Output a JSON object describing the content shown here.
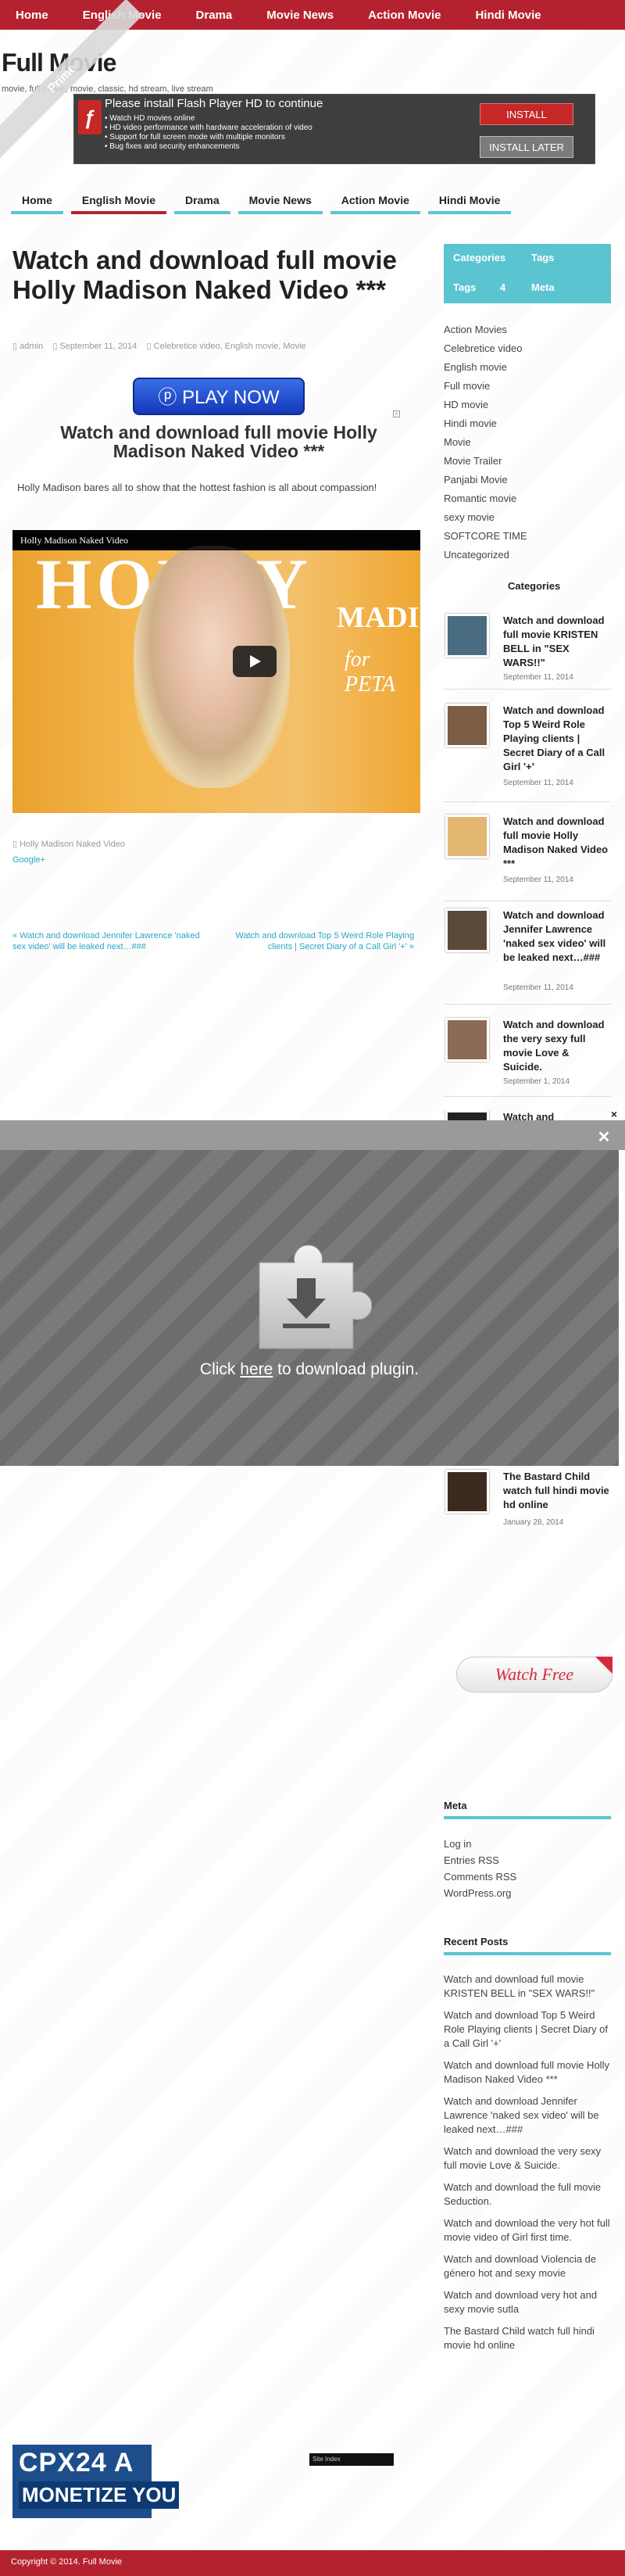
{
  "top_nav": [
    "Home",
    "English Movie",
    "Drama",
    "Movie News",
    "Action Movie",
    "Hindi Movie"
  ],
  "site": {
    "title": "Full Movie",
    "tagline": "movie, full movie, movie, classic, hd stream, live stream"
  },
  "flash_ad": {
    "message": "Please install Flash Player HD to continue",
    "features": [
      "Watch HD movies online",
      "HD video performance with hardware  acceleration of  video",
      "Support for full screen mode with  multiple monitors",
      "Bug fixes and security enhancements"
    ],
    "install": "INSTALL",
    "install_later": "INSTALL LATER",
    "corner_ribbon": "Prime"
  },
  "main_nav": [
    "Home",
    "English Movie",
    "Drama",
    "Movie News",
    "Action Movie",
    "Hindi Movie"
  ],
  "post": {
    "title": "Watch and download full movie Holly Madison Naked Video ***",
    "author": "admin",
    "date": "September 11, 2014",
    "categories": "Celebretice video, English movie, Movie",
    "play_now": "PLAY NOW",
    "subtitle": "Watch and download full movie Holly Madison Naked Video ***",
    "excerpt": "Holly Madison bares all to show that the hottest fashion is all about compassion!",
    "video_title": "Holly Madison Naked Video",
    "video_overlay": {
      "holly": "HOLLY",
      "madison": "MADIS",
      "peta": "for PETA"
    },
    "caption": "Holly Madison Naked Video",
    "google_plus": "Google+",
    "prev_link": "« Watch and download Jennifer Lawrence 'naked sex video' will be leaked next…###",
    "next_link": "Watch and download Top 5 Weird Role Playing clients | Secret Diary of a Call Girl '+' »"
  },
  "sidebar": {
    "tabs": [
      "Categories",
      "Tags",
      "Tags",
      "4",
      "Meta"
    ],
    "categories": [
      "Action Movies",
      "Celebretice video",
      "English movie",
      "Full movie",
      "HD movie",
      "Hindi movie",
      "Movie",
      "Movie Trailer",
      "Panjabi Movie",
      "Romantic movie",
      "sexy movie",
      "SOFTCORE TIME",
      "Uncategorized"
    ],
    "categories_heading": "Categories",
    "posts": [
      {
        "title": "Watch and download full movie KRISTEN BELL in \"SEX WARS!!\"",
        "date": "September 11, 2014"
      },
      {
        "title": "Watch and download Top 5 Weird Role Playing clients | Secret Diary of a Call Girl '+'",
        "date": "September 11, 2014"
      },
      {
        "title": "Watch and download full movie Holly Madison Naked Video ***",
        "date": "September 11, 2014"
      },
      {
        "title": "Watch and download Jennifer Lawrence 'naked sex video' will be leaked next…###",
        "date": "September 11, 2014"
      },
      {
        "title": "Watch and download the very sexy full movie Love & Suicide.",
        "date": "September 1, 2014"
      },
      {
        "title": "Watch and",
        "date": ""
      },
      {
        "title": "The Bastard Child watch full hindi movie hd online",
        "date": "January 28, 2014"
      }
    ],
    "watch_free": "Watch Free",
    "meta_title": "Meta",
    "meta_links": [
      "Log in",
      "Entries RSS",
      "Comments RSS",
      "WordPress.org"
    ],
    "recent_title": "Recent Posts",
    "recent_posts": [
      "Watch and download full movie KRISTEN BELL in \"SEX WARS!!\"",
      "Watch and download Top 5 Weird Role Playing clients | Secret Diary of a Call Girl '+'",
      "Watch and download full movie Holly Madison Naked Video ***",
      "Watch and download Jennifer Lawrence 'naked sex video' will be leaked next…###",
      "Watch and download the very sexy full movie Love & Suicide.",
      "Watch and download the full movie Seduction.",
      "Watch and download the very hot full movie video of Girl first time.",
      "Watch and download Violencia de género hot and sexy movie",
      "Watch and download very hot and sexy movie sutla",
      "The Bastard Child watch full hindi movie hd online"
    ]
  },
  "plugin_overlay": {
    "prefix": "Click ",
    "link": "here",
    "suffix": " to download plugin."
  },
  "cpx": {
    "line1": "CPX24 A",
    "line2": "MONETIZE YOU"
  },
  "counter": "Site Index",
  "footer": "Copyright © 2014. Full Movie"
}
